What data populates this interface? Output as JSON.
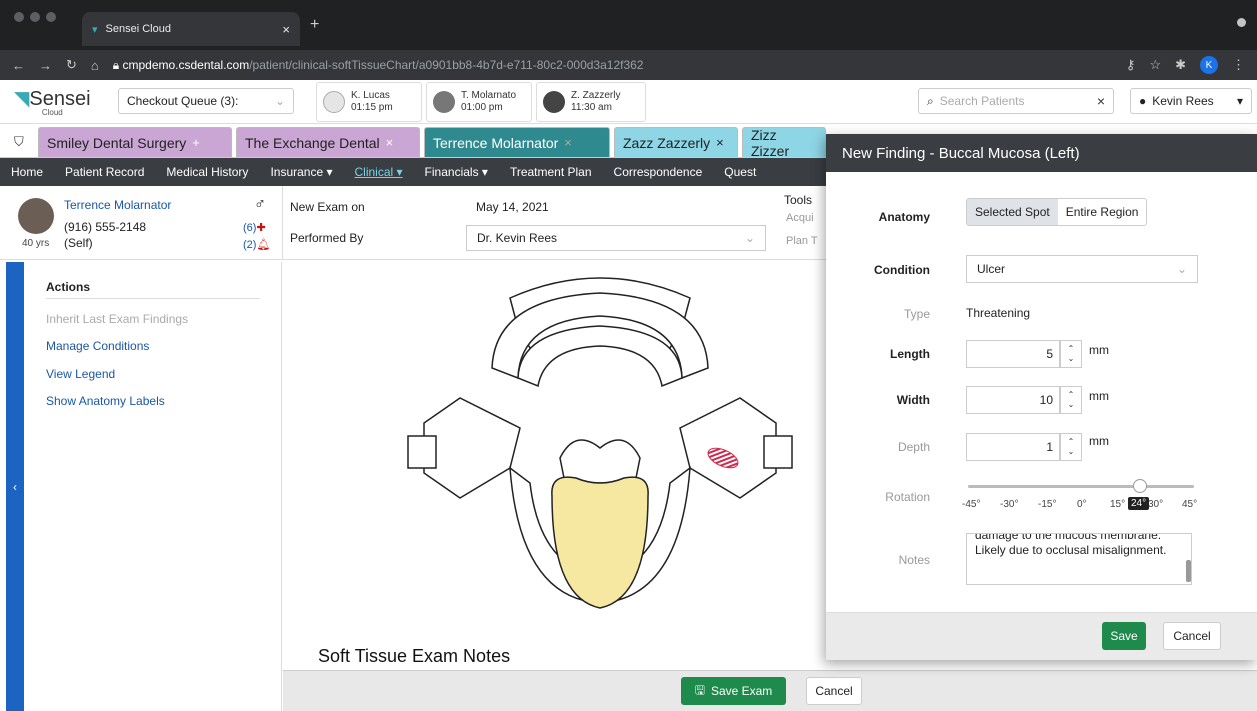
{
  "browser": {
    "tab_title": "Sensei Cloud",
    "url_host": "cmpdemo.csdental.com",
    "url_path": "/patient/clinical-softTissueChart/a0901bb8-4b7d-e711-80c2-000d3a12f362",
    "profile_initial": "K"
  },
  "header": {
    "logo": "Sensei",
    "logo_sub": "Cloud",
    "checkout_label": "Checkout Queue (3):",
    "appointments": [
      {
        "name": "K. Lucas",
        "time": "01:15 pm"
      },
      {
        "name": "T. Molarnato",
        "time": "01:00 pm"
      },
      {
        "name": "Z. Zazzerly",
        "time": "11:30 am"
      }
    ],
    "search_placeholder": "Search Patients",
    "user_name": "Kevin Rees"
  },
  "office_tabs": [
    {
      "label": "Smiley Dental Surgery",
      "bg": "#c9a6d4"
    },
    {
      "label": "The Exchange Dental",
      "bg": "#c9a6d4"
    },
    {
      "label": "Terrence Molarnator",
      "bg": "#2f8a8f"
    },
    {
      "label": "Zazz Zazzerly",
      "bg": "#8ed5e6"
    },
    {
      "label": "Zizz Zizzer",
      "bg": "#8ed5e6"
    }
  ],
  "nav": [
    "Home",
    "Patient Record",
    "Medical History",
    "Insurance ▾",
    "Clinical ▾",
    "Financials ▾",
    "Treatment Plan",
    "Correspondence",
    "Quest"
  ],
  "patient": {
    "name": "Terrence Molarnator",
    "phone": "(916) 555-2148",
    "relation": "(Self)",
    "age": "40 yrs",
    "gender_symbol": "♂",
    "count_alerts": "(6)",
    "count_bells": "(2)"
  },
  "exam": {
    "new_exam_label": "New Exam on",
    "date": "May 14, 2021",
    "performed_by_label": "Performed By",
    "performed_by": "Dr. Kevin Rees",
    "tools_label": "Tools",
    "tools_a": "Acqui",
    "tools_b": "Plan T"
  },
  "actions": {
    "heading": "Actions",
    "items": [
      "Inherit Last Exam Findings",
      "Manage Conditions",
      "View Legend",
      "Show Anatomy Labels"
    ]
  },
  "canvas": {
    "notes_title": "Soft Tissue Exam Notes",
    "save_exam": "Save Exam",
    "cancel": "Cancel"
  },
  "modal": {
    "title": "New Finding - Buccal Mucosa (Left)",
    "anatomy_label": "Anatomy",
    "anatomy_options": [
      "Selected Spot",
      "Entire Region"
    ],
    "condition_label": "Condition",
    "condition_value": "Ulcer",
    "type_label": "Type",
    "type_value": "Threatening",
    "length_label": "Length",
    "length_value": "5",
    "width_label": "Width",
    "width_value": "10",
    "depth_label": "Depth",
    "depth_value": "1",
    "unit": "mm",
    "rotation_label": "Rotation",
    "rotation_ticks": [
      "-45°",
      "-30°",
      "-15°",
      "0°",
      "15°",
      "30°",
      "45°"
    ],
    "rotation_value": "24°",
    "notes_label": "Notes",
    "notes_text": "damage to the mucous membrane. Likely due to occlusal misalignment.",
    "save": "Save",
    "cancel": "Cancel"
  },
  "colors": {
    "nav_bg": "#3a3e43",
    "save_green": "#1e8a4c",
    "link_blue": "#1a56a8",
    "tongue_yellow": "#f6e7a1",
    "lesion_red": "#d0284c"
  }
}
